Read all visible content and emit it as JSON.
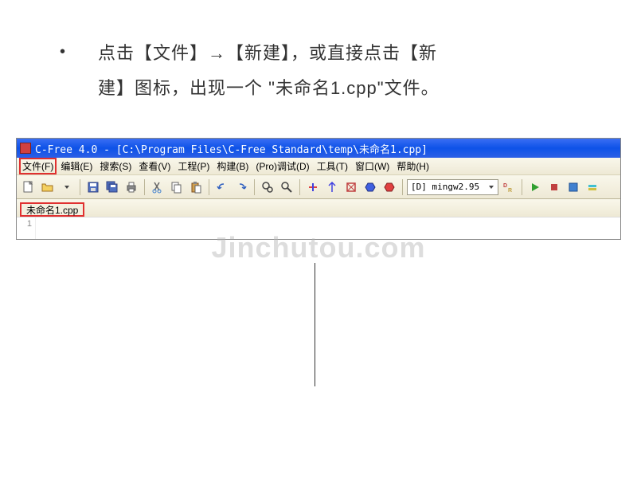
{
  "instruction": {
    "bullet": "•",
    "line1": "点击【文件】→【新建】，或直接点击【新",
    "line2": "建】图标，出现一个 \"未命名1.cpp\"文件。"
  },
  "titlebar": {
    "text": "C-Free 4.0 - [C:\\Program Files\\C-Free Standard\\temp\\未命名1.cpp]"
  },
  "menu": {
    "file": "文件(F)",
    "edit": "编辑(E)",
    "search": "搜索(S)",
    "view": "查看(V)",
    "project": "工程(P)",
    "build": "构建(B)",
    "debug": "(Pro)调试(D)",
    "tools": "工具(T)",
    "window": "窗口(W)",
    "help": "帮助(H)"
  },
  "toolbar": {
    "compiler": "[D] mingw2.95"
  },
  "tab": {
    "name": "未命名1.cpp"
  },
  "gutter": {
    "line1": "1"
  },
  "watermark": "Jinchutou.com"
}
